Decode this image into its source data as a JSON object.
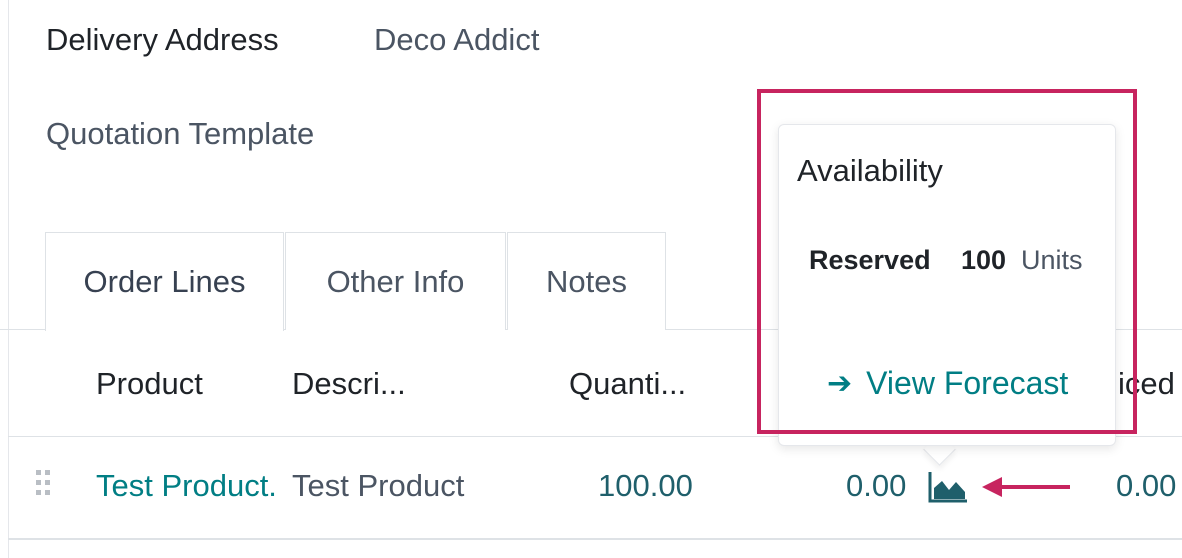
{
  "form": {
    "delivery_address": {
      "label": "Delivery Address",
      "value": "Deco Addict"
    },
    "quotation_template": {
      "label": "Quotation Template"
    }
  },
  "tabs": [
    {
      "label": "Order Lines",
      "active": true
    },
    {
      "label": "Other Info",
      "active": false
    },
    {
      "label": "Notes",
      "active": false
    }
  ],
  "table": {
    "headers": {
      "product": "Product",
      "description": "Descri...",
      "quantity": "Quanti...",
      "partial": "iced"
    },
    "rows": [
      {
        "product": "Test Product.",
        "description": "Test Product",
        "quantity": "100.00",
        "delivered": "0.00",
        "unit_price_partial": "0.00"
      }
    ]
  },
  "popover": {
    "title": "Availability",
    "reserved_label": "Reserved",
    "reserved_qty": "100",
    "reserved_unit": "Units",
    "link_label": "View Forecast",
    "link_icon": "arrow-right-icon"
  },
  "icons": {
    "forecast": "area-chart-icon",
    "drag_handle": "drag-handle-icon"
  },
  "colors": {
    "accent": "#017e84",
    "number": "#1f5f6b",
    "annotation": "#c7245f",
    "border": "#dee2e6"
  }
}
